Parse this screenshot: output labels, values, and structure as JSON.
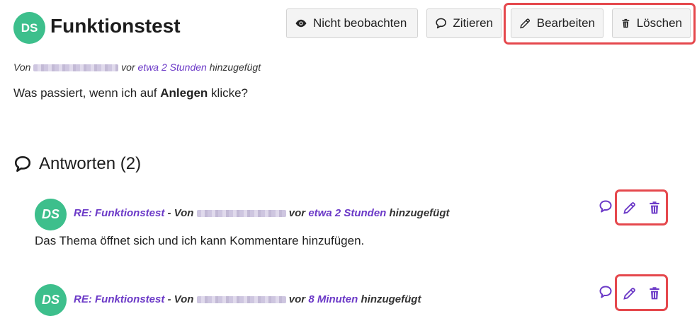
{
  "topic": {
    "avatar_initials": "DS",
    "title": "Funktionstest",
    "meta": {
      "prefix": "Von",
      "time_prefix": "vor",
      "time": "etwa 2 Stunden",
      "suffix": "hinzugefügt"
    },
    "body_before": "Was passiert, wenn ich auf",
    "body_bold": "Anlegen",
    "body_after": "klicke?"
  },
  "toolbar": {
    "watch_label": "Nicht beobachten",
    "quote_label": "Zitieren",
    "edit_label": "Bearbeiten",
    "delete_label": "Löschen"
  },
  "answers": {
    "heading": "Antworten (2)",
    "items": [
      {
        "initials": "DS",
        "subject": "RE: Funktionstest",
        "separator": " - Von ",
        "time_prefix": "vor",
        "time": "etwa 2 Stunden",
        "suffix": "hinzugefügt",
        "body": "Das Thema öffnet sich und ich kann Kommentare hinzufügen."
      },
      {
        "initials": "DS",
        "subject": "RE: Funktionstest",
        "separator": " - Von ",
        "time_prefix": "vor",
        "time": "8 Minuten",
        "suffix": "hinzugefügt",
        "body": ""
      }
    ]
  },
  "colors": {
    "accent": "#6b39c7",
    "avatar": "#3dbf8c",
    "highlight": "#e5484d"
  },
  "icons": [
    "eye-icon",
    "speech-bubble-icon",
    "pencil-icon",
    "trash-icon"
  ]
}
